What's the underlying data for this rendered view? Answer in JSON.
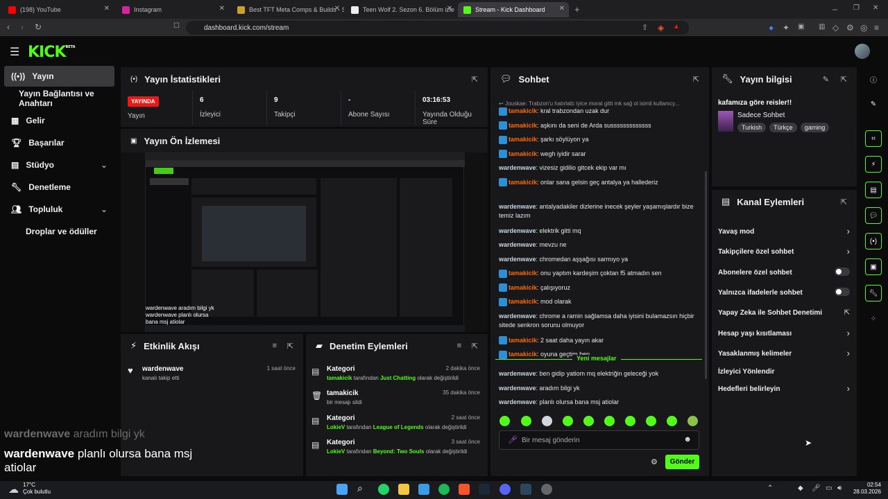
{
  "browser": {
    "tabs": [
      {
        "label": "(198) YouTube",
        "color": "#ff0000"
      },
      {
        "label": "Instagram",
        "color": "#d6249f"
      },
      {
        "label": "Best TFT Meta Comps & Builds - Set",
        "color": "#c9a227"
      },
      {
        "label": "Teen Wolf 2. Sezon 6. Bölüm izle - 10",
        "color": "#ffffff"
      },
      {
        "label": "Stream - Kick Dashboard",
        "color": "#53fc18"
      }
    ],
    "url": "dashboard.kick.com/stream"
  },
  "header": {
    "logo": "KICK",
    "logo_sup": "BETA"
  },
  "sidebar": {
    "items": [
      {
        "label": "Yayın",
        "icon": "broadcast-icon"
      },
      {
        "label": "Yayın Bağlantısı ve Anahtarı",
        "icon": ""
      },
      {
        "label": "Gelir",
        "icon": "revenue-icon"
      },
      {
        "label": "Başarılar",
        "icon": "trophy-icon"
      },
      {
        "label": "Stüdyo",
        "icon": "studio-icon"
      },
      {
        "label": "Denetleme",
        "icon": "wrench-icon"
      },
      {
        "label": "Topluluk",
        "icon": "community-icon"
      },
      {
        "label": "Droplar ve ödüller",
        "icon": ""
      }
    ]
  },
  "stats": {
    "title": "Yayın İstatistikleri",
    "live_badge": "YAYINDA",
    "live_label": "Yayın",
    "viewers_value": "6",
    "viewers_label": "İzleyici",
    "followers_value": "9",
    "followers_label": "Takipçi",
    "subs_value": "-",
    "subs_label": "Abone Sayısı",
    "duration_value": "03:16:53",
    "duration_label": "Yayında Olduğu Süre"
  },
  "preview": {
    "title": "Yayın Ön İzlemesi",
    "line1": "wardenwave aradım bilgi yk",
    "line2": "wardenwave planlı olursa bana msj atiolar"
  },
  "feed": {
    "title": "Etkinlik Akışı",
    "user": "wardenwave",
    "action": "kanalı takip etti",
    "time": "1 saat önce"
  },
  "modactions": {
    "title": "Denetim Eylemleri",
    "rows": [
      {
        "title": "Kategori",
        "by": "tamakicik",
        "mid": "tarafından",
        "val": "Just Chatting",
        "end": "olarak değiştirildi",
        "time": "2 dakika önce"
      },
      {
        "title": "tamakicik",
        "plain": "bir mesajı sildi",
        "time": "35 dakika önce"
      },
      {
        "title": "Kategori",
        "by": "LokieV",
        "mid": "tarafından",
        "val": "League of Legends",
        "end": "olarak değiştirildi",
        "time": "2 saat önce"
      },
      {
        "title": "Kategori",
        "by": "LokieV",
        "mid": "tarafından",
        "val": "Beyond: Two Souls",
        "end": "olarak değiştirildi",
        "time": "3 saat önce"
      }
    ]
  },
  "chat": {
    "title": "Sohbet",
    "reply": "Jouskae: Trabzon'u hatırlattı iyice moral gitti mk sağ ol isimli kullanıcy...",
    "messages": [
      {
        "user": "tamakicik",
        "mod": true,
        "text": ": kral trabzondan uzak dur"
      },
      {
        "user": "tamakicik",
        "mod": true,
        "text": ": aşkını da seni de Arda susssssssssssss"
      },
      {
        "user": "tamakicik",
        "mod": true,
        "text": ": şarkı söylüyon ya"
      },
      {
        "user": "tamakicik",
        "mod": true,
        "text": ": wegh iyidir sarar"
      },
      {
        "user": "wardenwave",
        "mod": false,
        "text": ": vizesiz gidilio gitcek ekip var mı"
      },
      {
        "user": "tamakicik",
        "mod": true,
        "text": ": onlar sana gelsin geç antalya ya hallederiz"
      },
      {
        "user": "wardenwave",
        "mod": false,
        "text": ": antalyadakiler dizlerine inecek şeyler yaşamışlardır bize temiz lazım"
      },
      {
        "user": "wardenwave",
        "mod": false,
        "text": ": elektrik gitti mq"
      },
      {
        "user": "wardenwave",
        "mod": false,
        "text": ": mevzu ne"
      },
      {
        "user": "wardenwave",
        "mod": false,
        "text": ": chromedan aşşağısı sarmıyo ya"
      },
      {
        "user": "tamakicik",
        "mod": true,
        "text": ": onu yaptım kardeşim çoktan f5 atmadın sen"
      },
      {
        "user": "tamakicik",
        "mod": true,
        "text": ": çalışıyoruz"
      },
      {
        "user": "tamakicik",
        "mod": true,
        "text": ": mod olarak"
      },
      {
        "user": "wardenwave",
        "mod": false,
        "text": ": chrome a ramin sağlamsa daha iyisini bulamazsın hiçbir sitede senkron sorunu olmuyor"
      },
      {
        "user": "tamakicik",
        "mod": true,
        "text": ": 2 saat daha yayın akar"
      },
      {
        "user": "tamakicik",
        "mod": true,
        "text": ": oyuna geçtim ben"
      }
    ],
    "new_label": "Yeni mesajlar",
    "new_messages": [
      {
        "user": "wardenwave",
        "text": ": ben gidip yatiom mq elektriğin geleceği yok"
      },
      {
        "user": "wardenwave",
        "text": ": aradım bilgi yk"
      },
      {
        "user": "wardenwave",
        "text": ": planlı olursa bana msj atiolar"
      }
    ],
    "placeholder": "Bir mesaj gönderin",
    "send_label": "Gönder"
  },
  "info": {
    "title": "Yayın bilgisi",
    "stream_title": "kafamıza göre reisler!!",
    "category": "Sadece Sohbet",
    "tags": [
      "Turkish",
      "Türkçe",
      "gaming"
    ]
  },
  "channel_actions": {
    "title": "Kanal Eylemleri",
    "items": [
      {
        "label": "Yavaş mod",
        "kind": "chevron"
      },
      {
        "label": "Takipçilere özel sohbet",
        "kind": "chevron"
      },
      {
        "label": "Abonelere özel sohbet",
        "kind": "toggle"
      },
      {
        "label": "Yalnızca ifadelerle sohbet",
        "kind": "toggle"
      },
      {
        "label": "Yapay Zeka ile Sohbet Denetimi",
        "kind": "external"
      },
      {
        "label": "Hesap yaşı kısıtlaması",
        "kind": "chevron"
      },
      {
        "label": "Yasaklanmış kelimeler",
        "kind": "chevron"
      },
      {
        "label": "İzleyici Yönlendir",
        "kind": "none"
      },
      {
        "label": "Hedefleri belirleyin",
        "kind": "chevron"
      }
    ]
  },
  "overlay": {
    "line1_user": "wardenwave",
    "line1_text": " aradım bilgi yk",
    "line2_user": "wardenwave",
    "line2_text": " planlı olursa bana msj atiolar"
  },
  "taskbar": {
    "weather_temp": "17°C",
    "weather_desc": "Çok bulutlu",
    "time": "02:54",
    "date": "28.03.2026"
  },
  "colors": {
    "accent": "#53fc18",
    "live": "#e91916",
    "panel": "#18181b"
  }
}
